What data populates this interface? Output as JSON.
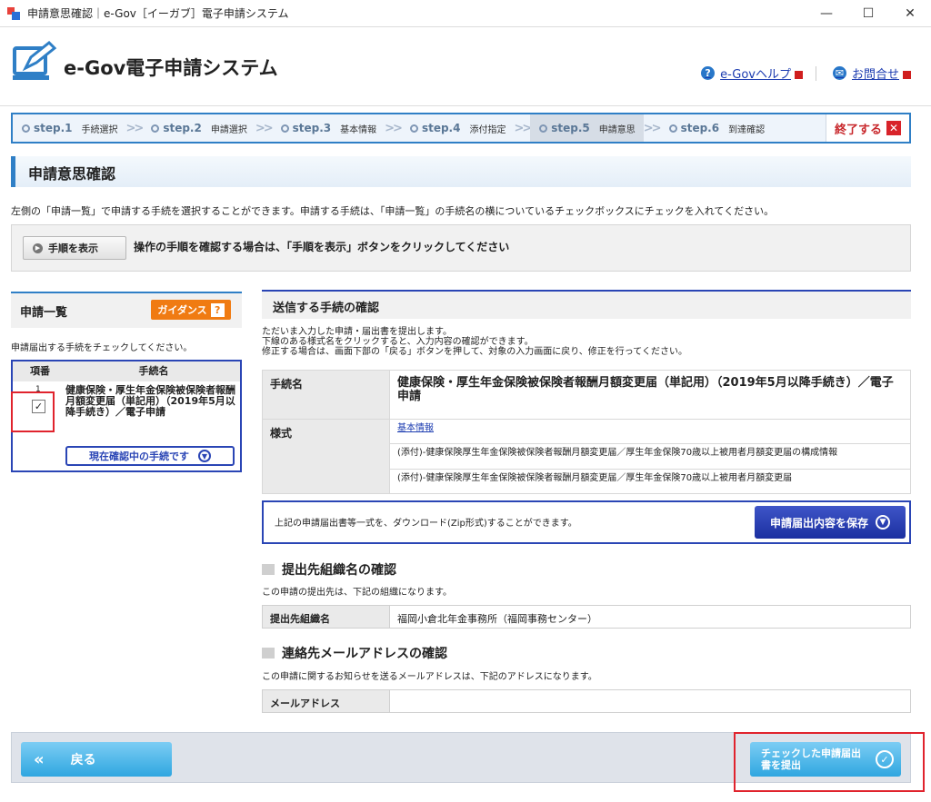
{
  "window": {
    "title": "申請意思確認｜e-Gov［イーガブ］電子申請システム",
    "minimize": "—",
    "maximize": "☐",
    "close": "✕"
  },
  "header": {
    "logo_text": "e-Gov電子申請システム",
    "help_link": "e-Govヘルプ",
    "contact_link": "お問合せ"
  },
  "steps": [
    {
      "num": "step.1",
      "label": "手続選択"
    },
    {
      "num": "step.2",
      "label": "申請選択"
    },
    {
      "num": "step.3",
      "label": "基本情報"
    },
    {
      "num": "step.4",
      "label": "添付指定"
    },
    {
      "num": "step.5",
      "label": "申請意思"
    },
    {
      "num": "step.6",
      "label": "到達確認"
    }
  ],
  "exit_label": "終了する",
  "page_title": "申請意思確認",
  "intro_text": "左側の「申請一覧」で申請する手続を選択することができます。申請する手続は、「申請一覧」の手続名の横についているチェックボックスにチェックを入れてください。",
  "procedure": {
    "button_label": "手順を表示",
    "text": "操作の手順を確認する場合は、「手順を表示」ボタンをクリックしてください"
  },
  "left_panel": {
    "title": "申請一覧",
    "guidance_label": "ガイダンス",
    "guidance_q": "?",
    "note": "申請届出する手続をチェックしてください。",
    "col_no": "項番",
    "col_name": "手続名",
    "item_no": "1",
    "item_checked": "✓",
    "item_name": "健康保険・厚生年金保険被保険者報酬月額変更届（単記用）（2019年5月以降手続き）／電子申請",
    "current_label": "現在確認中の手続です"
  },
  "right_panel": {
    "title": "送信する手続の確認",
    "desc_lines": [
      "ただいま入力した申請・届出書を提出します。",
      "下線のある様式名をクリックすると、入力内容の確認ができます。",
      "修正する場合は、画面下部の「戻る」ボタンを押して、対象の入力画面に戻り、修正を行ってください。"
    ],
    "proc_key": "手続名",
    "proc_value": "健康保険・厚生年金保険被保険者報酬月額変更届（単記用）（2019年5月以降手続き）／電子申請",
    "form_key": "様式",
    "forms": [
      "基本情報",
      "(添付)-健康保険厚生年金保険被保険者報酬月額変更届／厚生年金保険70歳以上被用者月額変更届の構成情報",
      "(添付)-健康保険厚生年金保険被保険者報酬月額変更届／厚生年金保険70歳以上被用者月額変更届"
    ],
    "download_text": "上記の申請届出書等一式を、ダウンロード(Zip形式)することができます。",
    "save_label": "申請届出内容を保存",
    "org_section_title": "提出先組織名の確認",
    "org_note": "この申請の提出先は、下記の組織になります。",
    "org_key": "提出先組織名",
    "org_value": "福岡小倉北年金事務所（福岡事務センター）",
    "mail_section_title": "連絡先メールアドレスの確認",
    "mail_note": "この申請に関するお知らせを送るメールアドレスは、下記のアドレスになります。",
    "mail_key": "メールアドレス",
    "mail_value": ""
  },
  "footer": {
    "back_label": "戻る",
    "back_chevron": "«",
    "submit_label": "チェックした申請届出書を提出"
  },
  "colors": {
    "accent": "#2f7fc6",
    "navy": "#2a45b5",
    "orange": "#f07b12",
    "highlight": "#e0232d"
  }
}
